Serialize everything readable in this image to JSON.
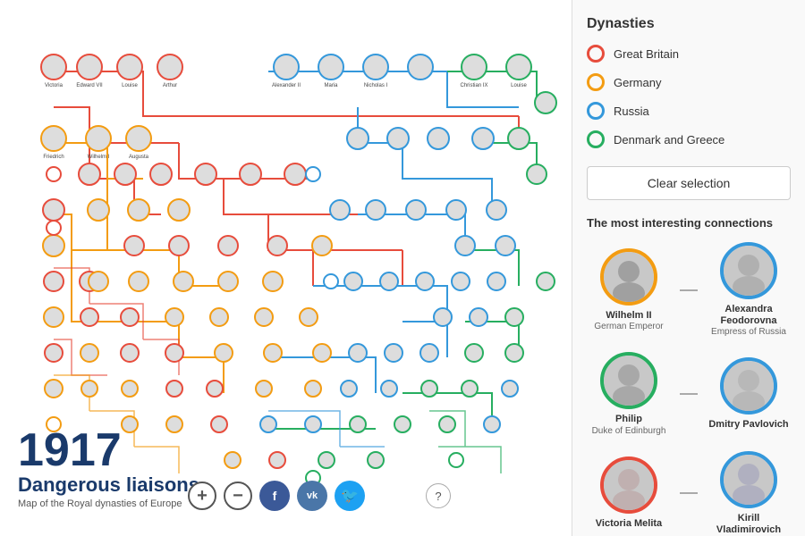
{
  "left": {
    "year": "1917",
    "subtitle": "Dangerous liaisons",
    "description": "Map of the Royal dynasties of Europe",
    "zoomIn": "+",
    "zoomOut": "−",
    "helpIcon": "?",
    "socialButtons": [
      {
        "label": "f",
        "name": "facebook",
        "color": "#3b5998"
      },
      {
        "label": "vk",
        "name": "vkontakte",
        "color": "#4a76a8"
      },
      {
        "label": "🐦",
        "name": "twitter",
        "color": "#1da1f2"
      }
    ]
  },
  "right": {
    "dynastiesTitle": "Dynasties",
    "dynasties": [
      {
        "name": "Great Britain",
        "color": "#e74c3c",
        "style": "circle"
      },
      {
        "name": "Germany",
        "color": "#f39c12",
        "style": "circle"
      },
      {
        "name": "Russia",
        "color": "#3498db",
        "style": "circle"
      },
      {
        "name": "Denmark and Greece",
        "color": "#27ae60",
        "style": "circle"
      }
    ],
    "clearSelectionLabel": "Clear selection",
    "connectionsTitle": "The most interesting connections",
    "connections": [
      {
        "person1": {
          "name": "Wilhelm II",
          "title": "German Emperor",
          "borderColor": "#f39c12"
        },
        "person2": {
          "name": "Alexandra Feodorovna",
          "title": "Empress of Russia",
          "borderColor": "#3498db"
        }
      },
      {
        "person1": {
          "name": "Philip",
          "title": "Duke of Edinburgh",
          "borderColor": "#27ae60"
        },
        "person2": {
          "name": "Dmitry Pavlovich",
          "title": "",
          "borderColor": "#3498db"
        }
      },
      {
        "person1": {
          "name": "Victoria Melita",
          "title": "",
          "borderColor": "#e74c3c"
        },
        "person2": {
          "name": "Kirill Vladimirovich",
          "title": "",
          "borderColor": "#3498db"
        }
      }
    ]
  }
}
